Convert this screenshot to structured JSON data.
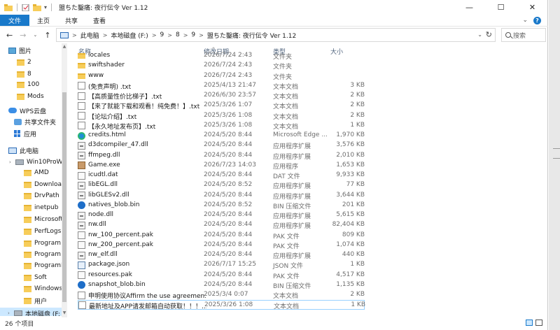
{
  "window": {
    "title": "盟ちた鑿痛: 夜行伝令 Ver 1.12",
    "controls": {
      "minimize": "—",
      "maximize": "☐",
      "close": "✕"
    }
  },
  "quick_access": {
    "dropdown": "▾"
  },
  "ribbon": {
    "tabs": [
      "文件",
      "主页",
      "共享",
      "查看"
    ],
    "expand_chevron": "⌄",
    "help": "?"
  },
  "nav_buttons": {
    "back": "←",
    "forward": "→",
    "recent": "⌄",
    "up": "↑"
  },
  "address": {
    "crumbs": [
      "此电脑",
      "本地磁盘 (F:)",
      "9",
      "8",
      "9",
      "盟ちた鑿痛: 夜行伝令 Ver 1.12"
    ],
    "separator": ">",
    "dropdown": "⌄",
    "refresh": "↻"
  },
  "search": {
    "placeholder": "搜索"
  },
  "navpane": {
    "items": [
      {
        "label": "图片",
        "icon": "pictures-icon"
      },
      {
        "label": "2",
        "icon": "folder-icon"
      },
      {
        "label": "8",
        "icon": "folder-icon"
      },
      {
        "label": "100",
        "icon": "folder-icon"
      },
      {
        "label": "Mods",
        "icon": "folder-icon"
      },
      {
        "label": "WPS云盘",
        "icon": "cloud-icon"
      },
      {
        "label": "共享文件夹",
        "icon": "shared-folder-icon"
      },
      {
        "label": "应用",
        "icon": "apps-icon"
      },
      {
        "label": "此电脑",
        "icon": "computer-icon"
      },
      {
        "label": "Win10ProW",
        "icon": "drive-icon"
      },
      {
        "label": "AMD",
        "icon": "folder-icon"
      },
      {
        "label": "Download",
        "icon": "folder-icon"
      },
      {
        "label": "DrvPath",
        "icon": "folder-icon"
      },
      {
        "label": "inetpub",
        "icon": "folder-icon"
      },
      {
        "label": "Microsoft",
        "icon": "folder-icon"
      },
      {
        "label": "PerfLogs",
        "icon": "folder-icon"
      },
      {
        "label": "Program I",
        "icon": "folder-icon"
      },
      {
        "label": "Program I",
        "icon": "folder-icon"
      },
      {
        "label": "ProgramD",
        "icon": "folder-icon"
      },
      {
        "label": "Soft",
        "icon": "folder-icon"
      },
      {
        "label": "Windows",
        "icon": "folder-icon"
      },
      {
        "label": "用户",
        "icon": "folder-icon"
      },
      {
        "label": "本地磁盘 (F:",
        "icon": "drive-icon"
      }
    ]
  },
  "columns": {
    "name": "名称",
    "date": "修改日期",
    "type": "类型",
    "size": "大小"
  },
  "files": [
    {
      "name": "locales",
      "date": "2026/7/24 2:43",
      "type": "文件夹",
      "size": "",
      "icon": "folder"
    },
    {
      "name": "swiftshader",
      "date": "2026/7/24 2:43",
      "type": "文件夹",
      "size": "",
      "icon": "folder"
    },
    {
      "name": "www",
      "date": "2026/7/24 2:43",
      "type": "文件夹",
      "size": "",
      "icon": "folder"
    },
    {
      "name": "(免责声明) .txt",
      "date": "2025/4/13 21:47",
      "type": "文本文档",
      "size": "3 KB",
      "icon": "txt"
    },
    {
      "name": "【高质量性价比梯子】.txt",
      "date": "2026/6/30 23:57",
      "type": "文本文档",
      "size": "2 KB",
      "icon": "txt"
    },
    {
      "name": "【来了就能下载和观看！纯免费！】.txt",
      "date": "2025/3/26 1:07",
      "type": "文本文档",
      "size": "2 KB",
      "icon": "txt"
    },
    {
      "name": "【论坛介绍】.txt",
      "date": "2025/3/26 1:08",
      "type": "文本文档",
      "size": "2 KB",
      "icon": "txt"
    },
    {
      "name": "【永久地址发布页】.txt",
      "date": "2025/3/26 1:08",
      "type": "文本文档",
      "size": "1 KB",
      "icon": "txt"
    },
    {
      "name": "credits.html",
      "date": "2024/5/20 8:44",
      "type": "Microsoft Edge ...",
      "size": "1,970 KB",
      "icon": "edge"
    },
    {
      "name": "d3dcompiler_47.dll",
      "date": "2024/5/20 8:44",
      "type": "应用程序扩展",
      "size": "3,576 KB",
      "icon": "dll"
    },
    {
      "name": "ffmpeg.dll",
      "date": "2024/5/20 8:44",
      "type": "应用程序扩展",
      "size": "2,010 KB",
      "icon": "dll"
    },
    {
      "name": "Game.exe",
      "date": "2026/7/23 14:03",
      "type": "应用程序",
      "size": "1,653 KB",
      "icon": "game"
    },
    {
      "name": "icudtl.dat",
      "date": "2024/5/20 8:44",
      "type": "DAT 文件",
      "size": "9,933 KB",
      "icon": "dat"
    },
    {
      "name": "libEGL.dll",
      "date": "2024/5/20 8:52",
      "type": "应用程序扩展",
      "size": "77 KB",
      "icon": "dll"
    },
    {
      "name": "libGLESv2.dll",
      "date": "2024/5/20 8:44",
      "type": "应用程序扩展",
      "size": "3,644 KB",
      "icon": "dll"
    },
    {
      "name": "natives_blob.bin",
      "date": "2024/5/20 8:52",
      "type": "BIN 压缩文件",
      "size": "201 KB",
      "icon": "bin"
    },
    {
      "name": "node.dll",
      "date": "2024/5/20 8:44",
      "type": "应用程序扩展",
      "size": "5,615 KB",
      "icon": "dll"
    },
    {
      "name": "nw.dll",
      "date": "2024/5/20 8:44",
      "type": "应用程序扩展",
      "size": "82,404 KB",
      "icon": "dll"
    },
    {
      "name": "nw_100_percent.pak",
      "date": "2024/5/20 8:44",
      "type": "PAK 文件",
      "size": "809 KB",
      "icon": "pak"
    },
    {
      "name": "nw_200_percent.pak",
      "date": "2024/5/20 8:44",
      "type": "PAK 文件",
      "size": "1,074 KB",
      "icon": "pak"
    },
    {
      "name": "nw_elf.dll",
      "date": "2024/5/20 8:44",
      "type": "应用程序扩展",
      "size": "440 KB",
      "icon": "dll"
    },
    {
      "name": "package.json",
      "date": "2026/7/17 15:25",
      "type": "JSON 文件",
      "size": "1 KB",
      "icon": "json"
    },
    {
      "name": "resources.pak",
      "date": "2024/5/20 8:44",
      "type": "PAK 文件",
      "size": "4,517 KB",
      "icon": "pak"
    },
    {
      "name": "snapshot_blob.bin",
      "date": "2024/5/20 8:44",
      "type": "BIN 压缩文件",
      "size": "1,135 KB",
      "icon": "bin"
    },
    {
      "name": "申明使用协议Affirm the use agreemen...",
      "date": "2025/3/4 0:07",
      "type": "文本文档",
      "size": "2 KB",
      "icon": "txt"
    },
    {
      "name": "最新地址及APP请发邮箱自动获取！！！....",
      "date": "2025/3/26 1:08",
      "type": "文本文档",
      "size": "1 KB",
      "icon": "txt"
    }
  ],
  "selected_row": 25,
  "scroll_arrows": {
    "up": "▲",
    "down": "▼"
  },
  "status": {
    "count": "26 个项目"
  }
}
